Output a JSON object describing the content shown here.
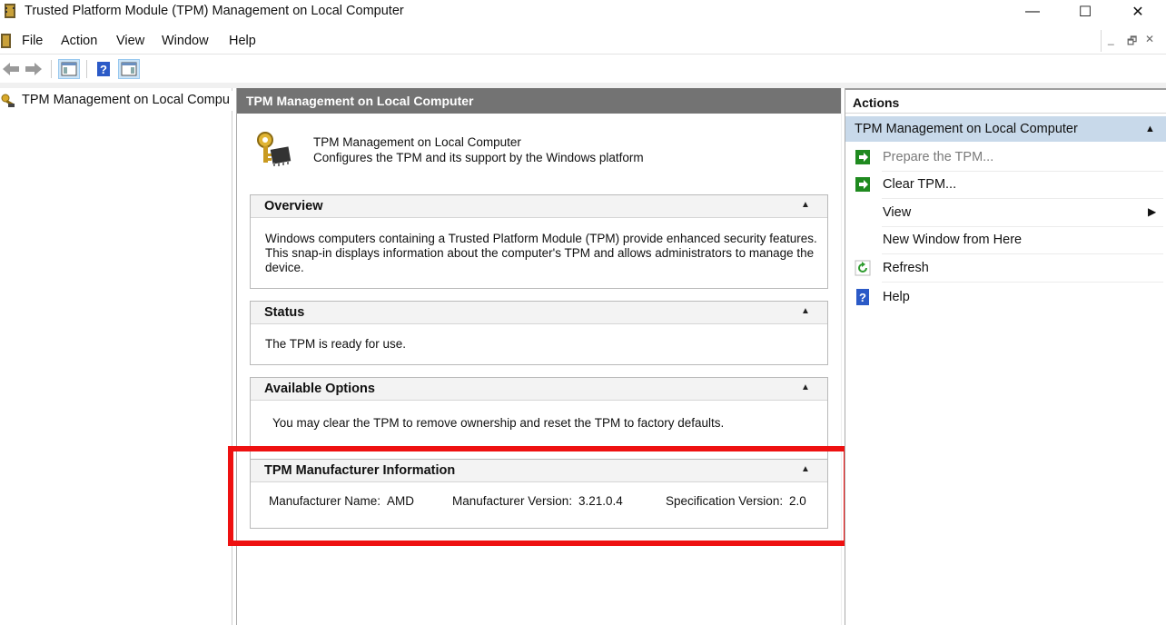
{
  "window": {
    "title": "Trusted Platform Module (TPM) Management on Local Computer",
    "minimize_glyph": "—",
    "maximize_glyph": "☐",
    "close_glyph": "✕"
  },
  "menu": {
    "items": [
      "File",
      "Action",
      "View",
      "Window",
      "Help"
    ]
  },
  "mdi": {
    "minimize_glyph": "_",
    "restore_glyph": "🗗",
    "close_glyph": "✕"
  },
  "toolbar": {
    "buttons": [
      "back-icon",
      "forward-icon",
      "show-hide-console-tree-icon",
      "help-icon",
      "show-hide-action-pane-icon"
    ]
  },
  "tree": {
    "items": [
      {
        "label": "TPM Management on Local Compu"
      }
    ]
  },
  "center": {
    "header": "TPM Management on Local Computer",
    "intro_title": "TPM Management on Local Computer",
    "intro_subtitle": "Configures the TPM and its support by the Windows platform",
    "sections": [
      {
        "title": "Overview",
        "lines": [
          "Windows computers containing a Trusted Platform Module (TPM) provide enhanced security features.",
          "This snap-in displays information about the computer's TPM and allows administrators to manage the",
          "device."
        ]
      },
      {
        "title": "Status",
        "lines": [
          "The TPM is ready for use."
        ]
      },
      {
        "title": "Available Options",
        "lines": [
          "You may clear the TPM to remove ownership and reset the TPM to factory defaults."
        ]
      },
      {
        "title": "TPM Manufacturer Information",
        "manufacturer_name_label": "Manufacturer Name:",
        "manufacturer_name": "AMD",
        "manufacturer_version_label": "Manufacturer Version:",
        "manufacturer_version": "3.21.0.4",
        "specification_version_label": "Specification Version:",
        "specification_version": "2.0"
      }
    ],
    "collapse_glyph": "▲"
  },
  "actions": {
    "header": "Actions",
    "group_label": "TPM Management on Local Computer",
    "items": [
      {
        "label": "Prepare the TPM...",
        "icon": "green-arrow-icon",
        "disabled": true
      },
      {
        "label": "Clear TPM...",
        "icon": "green-arrow-icon",
        "disabled": false
      },
      {
        "label": "View",
        "icon": "",
        "submenu": true
      },
      {
        "label": "New Window from Here",
        "icon": ""
      },
      {
        "label": "Refresh",
        "icon": "refresh-icon"
      },
      {
        "label": "Help",
        "icon": "help-icon"
      }
    ]
  },
  "colors": {
    "highlight": "#ee1111",
    "center_header_bg": "#737373",
    "action_group_bg": "#c8d9ea",
    "action_green": "#1f8a1f"
  }
}
